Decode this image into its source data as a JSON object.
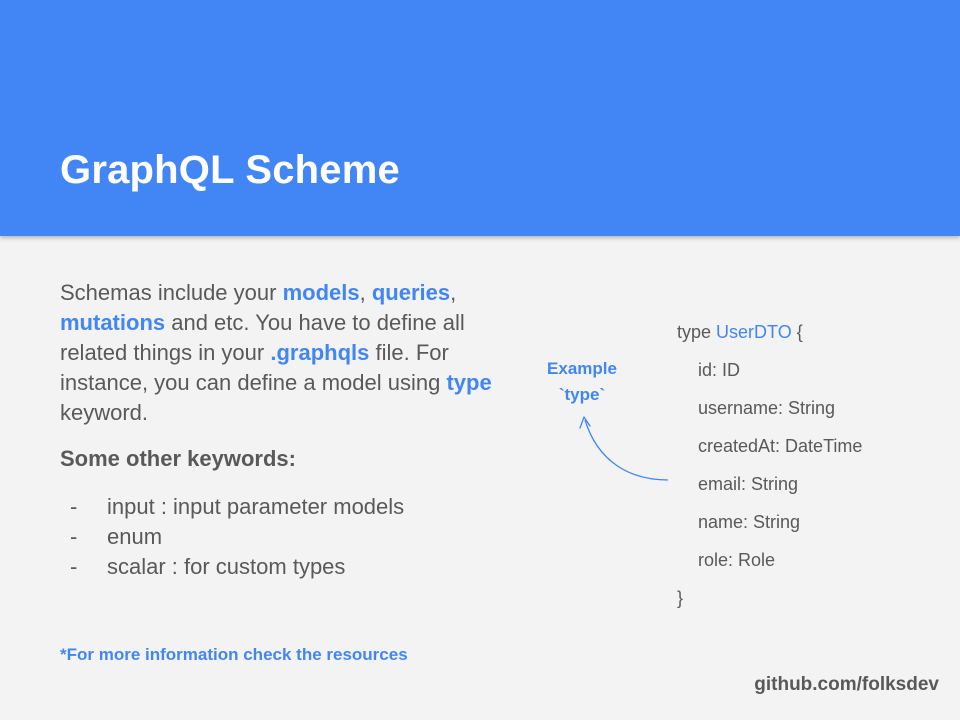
{
  "slide": {
    "title": "GraphQL Scheme",
    "intro": {
      "t1": "Schemas include your ",
      "models": "models",
      "c1": ",",
      "queries": "queries",
      "c2": ",",
      "mutations": "mutations",
      "t2": " and etc. You have to define all related things in your ",
      "graphqls": ".graphqls",
      "t3": " file. For instance, you can define a model using ",
      "type_kw": "type",
      "t4": " keyword."
    },
    "subheading": "Some other keywords:",
    "keywords": [
      {
        "dash": "-",
        "text": "input : input parameter models"
      },
      {
        "dash": "-",
        "text": "enum"
      },
      {
        "dash": "-",
        "text": "scalar : for custom types"
      }
    ],
    "note": "*For more information check the resources",
    "footer": "github.com/folksdev",
    "example_label": {
      "line1": "Example",
      "line2": "`type`"
    },
    "code": {
      "open_type": "type",
      "type_name": "UserDTO",
      "open_brace": "{",
      "fields": [
        "id: ID",
        "username: String",
        "createdAt: DateTime",
        "email: String",
        "name: String",
        "role: Role"
      ],
      "close": "}"
    },
    "colors": {
      "accent": "#4285f4",
      "text": "#595959",
      "background": "#f3f3f3"
    }
  }
}
